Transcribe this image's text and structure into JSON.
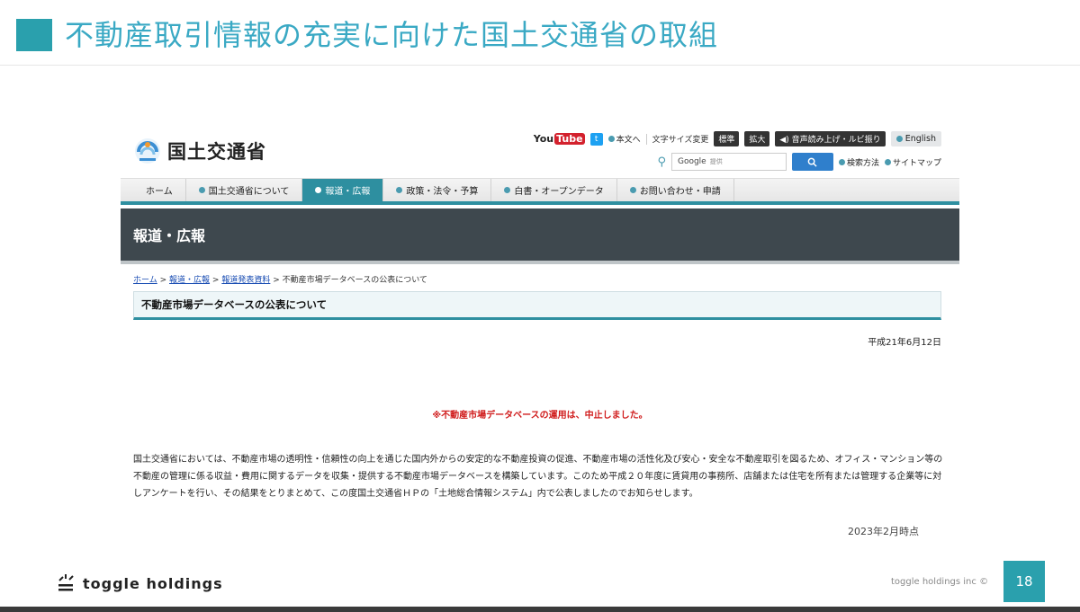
{
  "slide": {
    "title": "不動産取引情報の充実に向けた国土交通省の取組",
    "as_of": "2023年2月時点",
    "brand": "toggle holdings",
    "copyright": "toggle holdings inc ©",
    "page_number": "18"
  },
  "site": {
    "logo_text": "国土交通省",
    "youtube": "You",
    "youtube_tube": "Tube",
    "twitter_glyph": "t",
    "links": {
      "main_text": "本文へ",
      "font_size_label": "文字サイズ変更",
      "standard": "標準",
      "enlarge": "拡大",
      "read_aloud": "音声読み上げ・ルビ振り",
      "english": "English",
      "search_method": "検索方法",
      "sitemap": "サイトマップ"
    },
    "search": {
      "google": "Google",
      "placeholder": "提供"
    },
    "nav": [
      {
        "label": "ホーム"
      },
      {
        "label": "国土交通省について"
      },
      {
        "label": "報道・広報"
      },
      {
        "label": "政策・法令・予算"
      },
      {
        "label": "白書・オープンデータ"
      },
      {
        "label": "お問い合わせ・申請"
      }
    ],
    "banner": "報道・広報",
    "breadcrumb": {
      "home": "ホーム",
      "press": "報道・広報",
      "release": "報道発表資料",
      "current": "不動産市場データベースの公表について",
      "sep": ">"
    },
    "heading": "不動産市場データベースの公表について",
    "date": "平成21年6月12日",
    "notice": "※不動産市場データベースの運用は、中止しました。",
    "body": "国土交通省においては、不動産市場の透明性・信頼性の向上を通じた国内外からの安定的な不動産投資の促進、不動産市場の活性化及び安心・安全な不動産取引を図るため、オフィス・マンション等の不動産の管理に係る収益・費用に関するデータを収集・提供する不動産市場データベースを構築しています。このため平成２０年度に賃貸用の事務所、店舗または住宅を所有または管理する企業等に対しアンケートを行い、その結果をとりまとめて、この度国土交通省ＨＰの「土地総合情報システム」内で公表しましたのでお知らせします。"
  },
  "colors": {
    "accent": "#2aa0ad",
    "nav_active": "#2e8fa0",
    "banner_bg": "#3e484e",
    "notice_red": "#d01c1c"
  }
}
